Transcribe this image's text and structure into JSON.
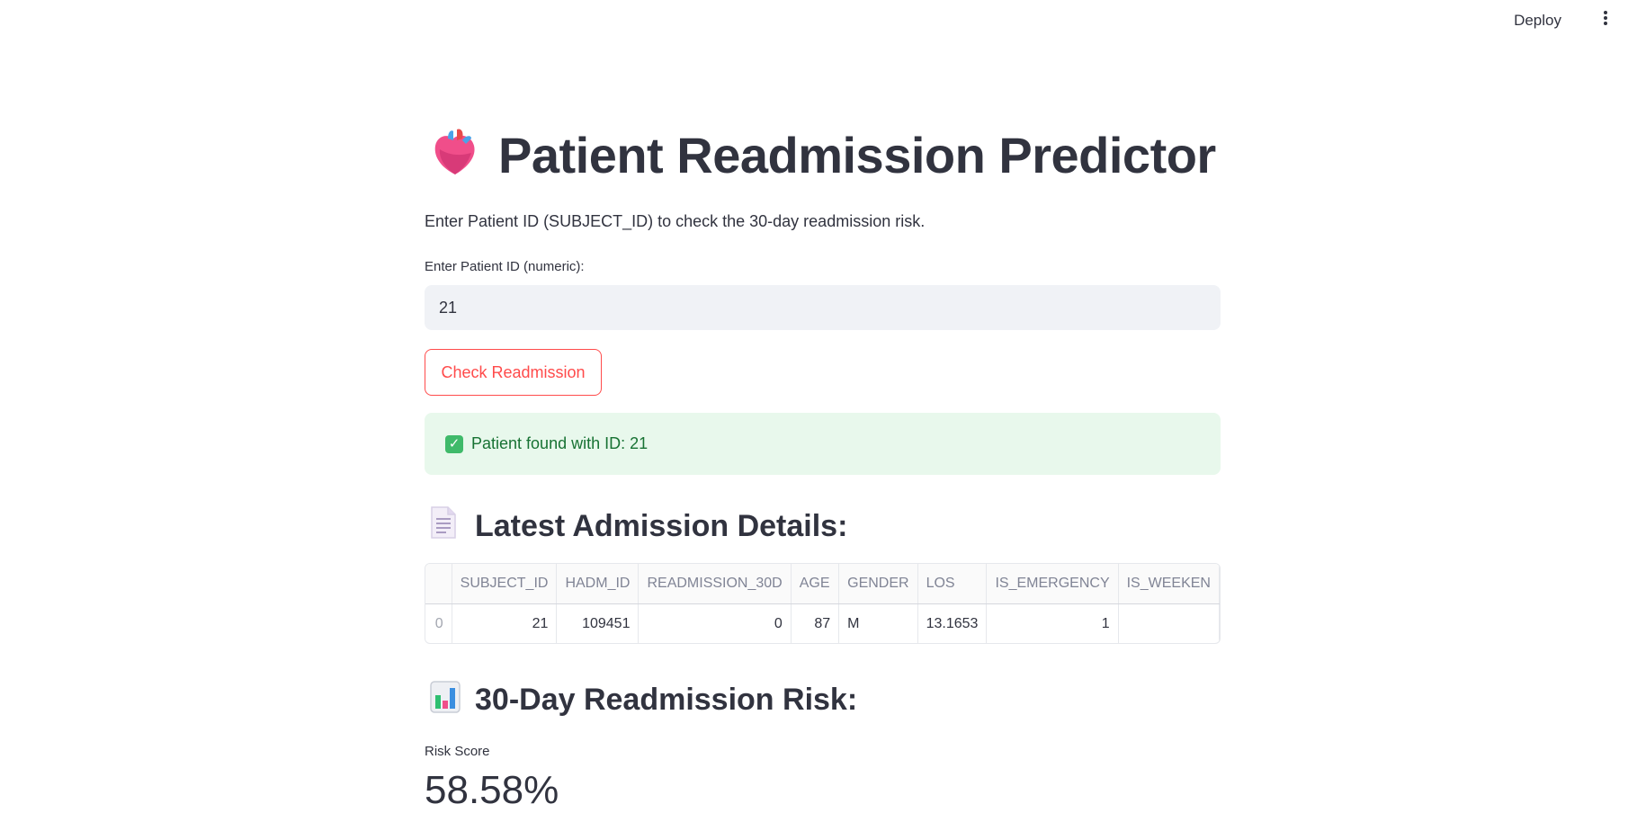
{
  "header": {
    "deploy_label": "Deploy",
    "menu_icon": "kebab-menu-icon"
  },
  "page": {
    "title": "Patient Readmission Predictor",
    "title_icon": "anatomical-heart-icon",
    "subtitle": "Enter Patient ID (SUBJECT_ID) to check the 30-day readmission risk."
  },
  "input": {
    "label": "Enter Patient ID (numeric):",
    "value": "21"
  },
  "button": {
    "check_label": "Check Readmission"
  },
  "alert": {
    "icon": "check-mark-button-icon",
    "text": "Patient found with ID: 21",
    "color": "#177233"
  },
  "admission": {
    "heading": "Latest Admission Details:",
    "heading_icon": "page-facing-up-icon",
    "columns": [
      "",
      "SUBJECT_ID",
      "HADM_ID",
      "READMISSION_30D",
      "AGE",
      "GENDER",
      "LOS",
      "IS_EMERGENCY",
      "IS_WEEKEN"
    ],
    "rows": [
      [
        "0",
        "21",
        "109451",
        "0",
        "87",
        "M",
        "13.1653",
        "1",
        ""
      ]
    ]
  },
  "risk": {
    "heading": "30-Day Readmission Risk:",
    "heading_icon": "bar-chart-icon",
    "label": "Risk Score",
    "value": "58.58%"
  },
  "colors": {
    "accent": "#ff4b4b",
    "success_bg": "#e8f8ec",
    "text": "#31333f"
  }
}
